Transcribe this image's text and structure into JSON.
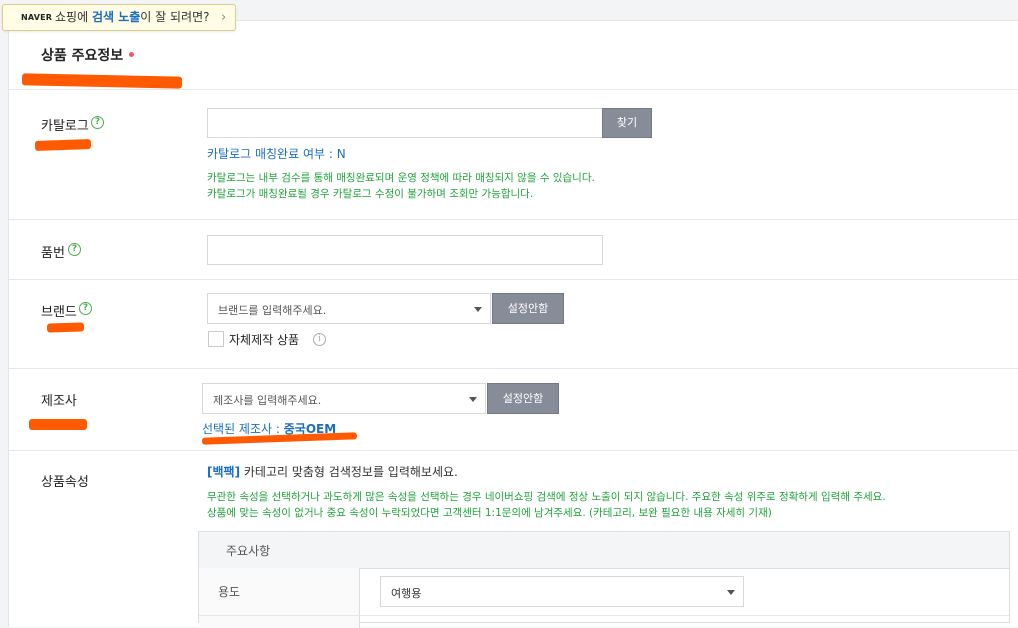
{
  "tooltip": {
    "brand": "NAVER",
    "part1": "쇼핑에 ",
    "highlight": "검색 노출",
    "part2": "이 잘 되려면?",
    "chevron": "›"
  },
  "section": {
    "title": "상품 주요정보"
  },
  "catalog": {
    "label": "카탈로그",
    "search_button": "찾기",
    "match_status": "카탈로그 매칭완료 여부 : N",
    "notice_line1": "카탈로그는 내부 검수를 통해 매칭완료되며 운영 정책에 따라 매칭되지 않을 수 있습니다.",
    "notice_line2": "카탈로그가 매칭완료될 경우 카탈로그 수정이 불가하며 조회만 가능합니다."
  },
  "model": {
    "label": "품번"
  },
  "brand": {
    "label": "브랜드",
    "placeholder": "브랜드를 입력해주세요.",
    "unset_button": "설정안함",
    "self_made_label": "자체제작 상품"
  },
  "maker": {
    "label": "제조사",
    "placeholder": "제조사를 입력해주세요.",
    "unset_button": "설정안함",
    "selected_prefix": "선택된 제조사 : ",
    "selected_value": "중국OEM"
  },
  "attributes": {
    "label": "상품속성",
    "tag": "[백팩]",
    "intro": " 카테고리 맞춤형 검색정보를 입력해보세요.",
    "notice_line1": "무관한 속성을 선택하거나 과도하게 많은 속성을 선택하는 경우 네이버쇼핑 검색에 정상 노출이 되지 않습니다. 주요한 속성 위주로 정확하게 입력해 주세요.",
    "notice_line2": "상품에 맞는 속성이 없거나 중요 속성이 누락되었다면 고객센터 1:1문의에 남겨주세요. (카테고리, 보완 필요한 내용 자세히 기재)",
    "table_header": "주요사항",
    "rows": [
      {
        "name": "용도",
        "value": "여행용"
      }
    ]
  },
  "icons": {
    "question": "question-circle-icon",
    "info": "info-circle-icon",
    "caret": "caret-down-icon"
  },
  "colors": {
    "accent_blue": "#1b6ec2",
    "notice_green": "#20a33a",
    "required_red": "#f35566",
    "annotation_orange": "#ff5a00",
    "button_gray": "#868d99"
  }
}
